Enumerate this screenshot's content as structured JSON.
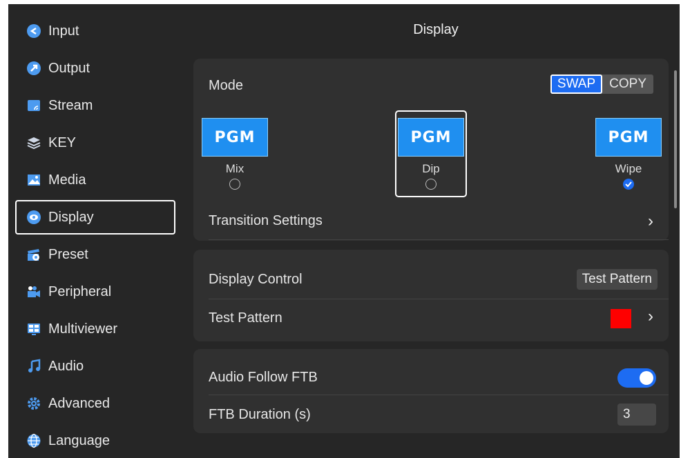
{
  "sidebar": {
    "items": [
      {
        "label": "Input",
        "icon": "input-icon"
      },
      {
        "label": "Output",
        "icon": "output-icon"
      },
      {
        "label": "Stream",
        "icon": "stream-icon"
      },
      {
        "label": "KEY",
        "icon": "key-layers-icon"
      },
      {
        "label": "Media",
        "icon": "media-icon"
      },
      {
        "label": "Display",
        "icon": "display-icon",
        "active": true
      },
      {
        "label": "Preset",
        "icon": "preset-icon"
      },
      {
        "label": "Peripheral",
        "icon": "peripheral-icon"
      },
      {
        "label": "Multiviewer",
        "icon": "multiviewer-icon"
      },
      {
        "label": "Audio",
        "icon": "audio-icon"
      },
      {
        "label": "Advanced",
        "icon": "advanced-icon"
      },
      {
        "label": "Language",
        "icon": "language-icon"
      }
    ]
  },
  "page": {
    "title": "Display"
  },
  "mode": {
    "label": "Mode",
    "options": [
      "SWAP",
      "COPY"
    ],
    "selected": "SWAP"
  },
  "transitions": [
    {
      "thumb": "PGM",
      "name": "Mix",
      "checked": false
    },
    {
      "thumb": "PGM",
      "name": "Dip",
      "checked": false
    },
    {
      "thumb": "PGM",
      "name": "Wipe",
      "checked": true
    }
  ],
  "transition_settings": {
    "label": "Transition Settings"
  },
  "display_control": {
    "label": "Display Control",
    "value": "Test Pattern"
  },
  "test_pattern": {
    "label": "Test Pattern",
    "color": "#ff0000"
  },
  "audio_follow_ftb": {
    "label": "Audio Follow FTB",
    "enabled": true
  },
  "ftb_duration": {
    "label": "FTB Duration (s)",
    "value": "3"
  },
  "colors": {
    "accent": "#1d6cf2",
    "background": "#262626",
    "card": "#303030"
  }
}
